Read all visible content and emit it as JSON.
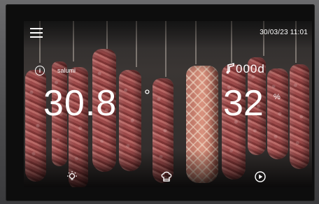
{
  "header": {
    "menu_icon": "hamburger-menu-icon",
    "datetime": "30/03/23 11:01"
  },
  "program": {
    "icon": "info-icon",
    "info_glyph": "i",
    "name": "salumi"
  },
  "timer": {
    "icon": "timer-bell-icon",
    "value": "000d"
  },
  "temperature": {
    "value": "30.8",
    "unit": "°"
  },
  "humidity": {
    "value": "32",
    "unit": "%"
  },
  "bottom_bar": {
    "items": [
      {
        "icon": "light-bulb-icon"
      },
      {
        "icon": "chef-hat-icon"
      },
      {
        "icon": "play-icon"
      }
    ]
  },
  "colors": {
    "text": "#ffffff",
    "bezel": "#0d0d0d",
    "frame": "#5a5a5c"
  }
}
